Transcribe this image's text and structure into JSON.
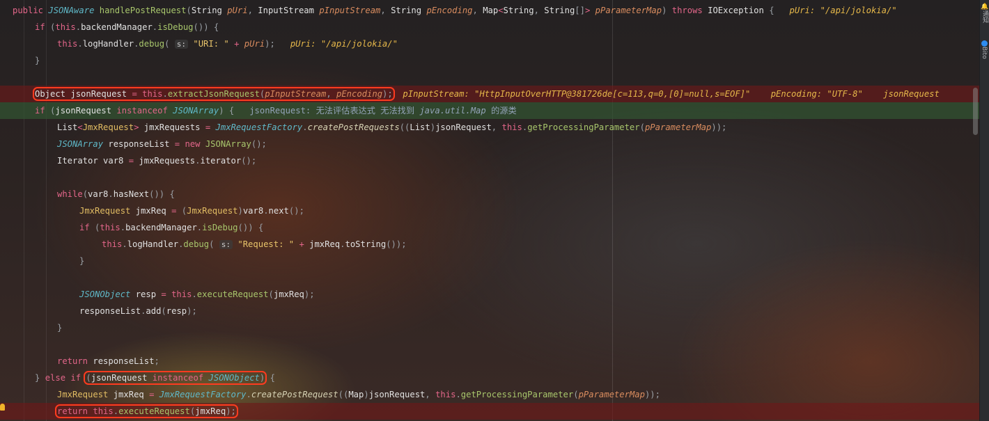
{
  "lines": [
    {
      "indent": 0,
      "tokens": [
        [
          "public ",
          "k"
        ],
        [
          "JSONAware ",
          "t"
        ],
        [
          "handlePostRequest",
          "m"
        ],
        [
          "(",
          "g"
        ],
        [
          "String ",
          "n"
        ],
        [
          "pUri",
          "p"
        ],
        [
          ", ",
          "g"
        ],
        [
          "InputStream ",
          "n"
        ],
        [
          "pInputStream",
          "p"
        ],
        [
          ", ",
          "g"
        ],
        [
          "String ",
          "n"
        ],
        [
          "pEncoding",
          "p"
        ],
        [
          ", ",
          "g"
        ],
        [
          "Map",
          "n"
        ],
        [
          "<",
          "k"
        ],
        [
          "String",
          "n"
        ],
        [
          ", ",
          "g"
        ],
        [
          "String",
          "n"
        ],
        [
          "[]",
          "g"
        ],
        [
          "> ",
          "k"
        ],
        [
          "pParameterMap",
          "p"
        ],
        [
          ") ",
          "g"
        ],
        [
          "throws ",
          "k"
        ],
        [
          "IOException ",
          "n"
        ],
        [
          "{",
          "g"
        ],
        [
          "   pUri: \"/api/jolokia/\"",
          "h"
        ]
      ]
    },
    {
      "indent": 1,
      "tokens": [
        [
          "if ",
          "k"
        ],
        [
          "(",
          "g"
        ],
        [
          "this",
          "k"
        ],
        [
          ".",
          "g"
        ],
        [
          "backendManager",
          "n"
        ],
        [
          ".",
          "g"
        ],
        [
          "isDebug",
          "m"
        ],
        [
          "()) {",
          "g"
        ]
      ]
    },
    {
      "indent": 2,
      "tokens": [
        [
          "this",
          "k"
        ],
        [
          ".",
          "g"
        ],
        [
          "logHandler",
          "n"
        ],
        [
          ".",
          "g"
        ],
        [
          "debug",
          "m"
        ],
        [
          "( ",
          "g"
        ],
        [
          "s:",
          "i"
        ],
        [
          " \"URI: \" ",
          "s"
        ],
        [
          "+ ",
          "k"
        ],
        [
          "pUri",
          "p"
        ],
        [
          ");",
          "g"
        ],
        [
          "   pUri: \"/api/jolokia/\"",
          "h"
        ]
      ]
    },
    {
      "indent": 1,
      "tokens": [
        [
          "}",
          "g"
        ]
      ]
    },
    {
      "indent": 0,
      "tokens": []
    },
    {
      "indent": 1,
      "bg": "red",
      "tokens": [
        [
          "Object ",
          "n",
          1
        ],
        [
          "jsonRequest ",
          "n",
          1
        ],
        [
          "= ",
          "k",
          1
        ],
        [
          "this",
          "k",
          1
        ],
        [
          ".",
          "g",
          1
        ],
        [
          "extractJsonRequest",
          "m",
          1
        ],
        [
          "(",
          "g",
          1
        ],
        [
          "pInputStream",
          "p",
          1
        ],
        [
          ", ",
          "g",
          1
        ],
        [
          "pEncoding",
          "p",
          1
        ],
        [
          ");",
          "g",
          1
        ],
        [
          "  pInputStream: \"HttpInputOverHTTP@381726de[c=113,q=0,[0]=null,s=EOF]\"    pEncoding: \"UTF-8\"    jsonRequest",
          "h"
        ]
      ]
    },
    {
      "indent": 1,
      "bg": "green",
      "tokens": [
        [
          "if ",
          "k"
        ],
        [
          "(",
          "g"
        ],
        [
          "jsonRequest ",
          "n"
        ],
        [
          "instanceof ",
          "k"
        ],
        [
          "JSONArray",
          "t"
        ],
        [
          ") {",
          "g"
        ],
        [
          "   jsonRequest: 无法评估表达式 无法找到 ",
          "c"
        ],
        [
          "java.util.Map",
          "ci"
        ],
        [
          " 的源类",
          "c"
        ]
      ]
    },
    {
      "indent": 2,
      "tokens": [
        [
          "List",
          "n"
        ],
        [
          "<",
          "k"
        ],
        [
          "JmxRequest",
          "y"
        ],
        [
          "> ",
          "k"
        ],
        [
          "jmxRequests ",
          "n"
        ],
        [
          "= ",
          "k"
        ],
        [
          "JmxRequestFactory",
          "t"
        ],
        [
          ".",
          "g"
        ],
        [
          "createPostRequests",
          "f"
        ],
        [
          "((",
          "g"
        ],
        [
          "List",
          "n"
        ],
        [
          ")",
          "g"
        ],
        [
          "jsonRequest",
          "n"
        ],
        [
          ", ",
          "g"
        ],
        [
          "this",
          "k"
        ],
        [
          ".",
          "g"
        ],
        [
          "getProcessingParameter",
          "m"
        ],
        [
          "(",
          "g"
        ],
        [
          "pParameterMap",
          "p"
        ],
        [
          "));",
          "g"
        ]
      ]
    },
    {
      "indent": 2,
      "tokens": [
        [
          "JSONArray ",
          "t"
        ],
        [
          "responseList ",
          "n"
        ],
        [
          "= ",
          "k"
        ],
        [
          "new ",
          "k"
        ],
        [
          "JSONArray",
          "m"
        ],
        [
          "();",
          "g"
        ]
      ]
    },
    {
      "indent": 2,
      "tokens": [
        [
          "Iterator ",
          "n"
        ],
        [
          "var8 ",
          "n"
        ],
        [
          "= ",
          "k"
        ],
        [
          "jmxRequests",
          "n"
        ],
        [
          ".",
          "g"
        ],
        [
          "iterator",
          "n"
        ],
        [
          "();",
          "g"
        ]
      ]
    },
    {
      "indent": 0,
      "tokens": []
    },
    {
      "indent": 2,
      "tokens": [
        [
          "while",
          "k"
        ],
        [
          "(",
          "g"
        ],
        [
          "var8",
          "n"
        ],
        [
          ".",
          "g"
        ],
        [
          "hasNext",
          "n"
        ],
        [
          "()) {",
          "g"
        ]
      ]
    },
    {
      "indent": 3,
      "tokens": [
        [
          "JmxRequest ",
          "y"
        ],
        [
          "jmxReq ",
          "n"
        ],
        [
          "= ",
          "k"
        ],
        [
          "(",
          "g"
        ],
        [
          "JmxRequest",
          "y"
        ],
        [
          ")",
          "g"
        ],
        [
          "var8",
          "n"
        ],
        [
          ".",
          "g"
        ],
        [
          "next",
          "n"
        ],
        [
          "();",
          "g"
        ]
      ]
    },
    {
      "indent": 3,
      "tokens": [
        [
          "if ",
          "k"
        ],
        [
          "(",
          "g"
        ],
        [
          "this",
          "k"
        ],
        [
          ".",
          "g"
        ],
        [
          "backendManager",
          "n"
        ],
        [
          ".",
          "g"
        ],
        [
          "isDebug",
          "m"
        ],
        [
          "()) {",
          "g"
        ]
      ]
    },
    {
      "indent": 4,
      "tokens": [
        [
          "this",
          "k"
        ],
        [
          ".",
          "g"
        ],
        [
          "logHandler",
          "n"
        ],
        [
          ".",
          "g"
        ],
        [
          "debug",
          "m"
        ],
        [
          "( ",
          "g"
        ],
        [
          "s:",
          "i"
        ],
        [
          " \"Request: \" ",
          "s"
        ],
        [
          "+ ",
          "k"
        ],
        [
          "jmxReq",
          "n"
        ],
        [
          ".",
          "g"
        ],
        [
          "toString",
          "n"
        ],
        [
          "());",
          "g"
        ]
      ]
    },
    {
      "indent": 3,
      "tokens": [
        [
          "}",
          "g"
        ]
      ]
    },
    {
      "indent": 0,
      "tokens": []
    },
    {
      "indent": 3,
      "tokens": [
        [
          "JSONObject ",
          "t"
        ],
        [
          "resp ",
          "n"
        ],
        [
          "= ",
          "k"
        ],
        [
          "this",
          "k"
        ],
        [
          ".",
          "g"
        ],
        [
          "executeRequest",
          "m"
        ],
        [
          "(",
          "g"
        ],
        [
          "jmxReq",
          "n"
        ],
        [
          ");",
          "g"
        ]
      ]
    },
    {
      "indent": 3,
      "tokens": [
        [
          "responseList",
          "n"
        ],
        [
          ".",
          "g"
        ],
        [
          "add",
          "n"
        ],
        [
          "(",
          "g"
        ],
        [
          "resp",
          "n"
        ],
        [
          ");",
          "g"
        ]
      ]
    },
    {
      "indent": 2,
      "tokens": [
        [
          "}",
          "g"
        ]
      ]
    },
    {
      "indent": 0,
      "tokens": []
    },
    {
      "indent": 2,
      "tokens": [
        [
          "return ",
          "k"
        ],
        [
          "responseList",
          "n"
        ],
        [
          ";",
          "g"
        ]
      ]
    },
    {
      "indent": 1,
      "tokens": [
        [
          "} ",
          "g"
        ],
        [
          "else if ",
          "k"
        ],
        [
          "(",
          "g",
          1
        ],
        [
          "jsonRequest ",
          "n",
          1
        ],
        [
          "instanceof ",
          "k",
          1
        ],
        [
          "JSONObject",
          "t",
          1
        ],
        [
          ")",
          "g",
          1
        ],
        [
          " {",
          "g"
        ]
      ]
    },
    {
      "indent": 2,
      "tokens": [
        [
          "JmxRequest ",
          "y"
        ],
        [
          "jmxReq ",
          "n"
        ],
        [
          "= ",
          "k"
        ],
        [
          "JmxRequestFactory",
          "t"
        ],
        [
          ".",
          "g"
        ],
        [
          "createPostRequest",
          "f"
        ],
        [
          "((",
          "g"
        ],
        [
          "Map",
          "n"
        ],
        [
          ")",
          "g"
        ],
        [
          "jsonRequest",
          "n"
        ],
        [
          ", ",
          "g"
        ],
        [
          "this",
          "k"
        ],
        [
          ".",
          "g"
        ],
        [
          "getProcessingParameter",
          "m"
        ],
        [
          "(",
          "g"
        ],
        [
          "pParameterMap",
          "p"
        ],
        [
          "));",
          "g"
        ]
      ]
    },
    {
      "indent": 2,
      "bg": "red",
      "tokens": [
        [
          "return ",
          "k",
          1
        ],
        [
          "this",
          "k",
          1
        ],
        [
          ".",
          "g",
          1
        ],
        [
          "executeRequest",
          "m",
          1
        ],
        [
          "(",
          "g",
          1
        ],
        [
          "jmxReq",
          "n",
          1
        ],
        [
          ");",
          "g",
          1
        ]
      ]
    }
  ],
  "toolstrip": {
    "notifications": "通知",
    "bito": "Bito"
  },
  "colors": {
    "keyword": "#e3668a",
    "type": "#5fb8c8",
    "method": "#a8c66c",
    "param": "#d98c5f",
    "string": "#e8c46a",
    "highlight_box": "#ff3b1f"
  }
}
